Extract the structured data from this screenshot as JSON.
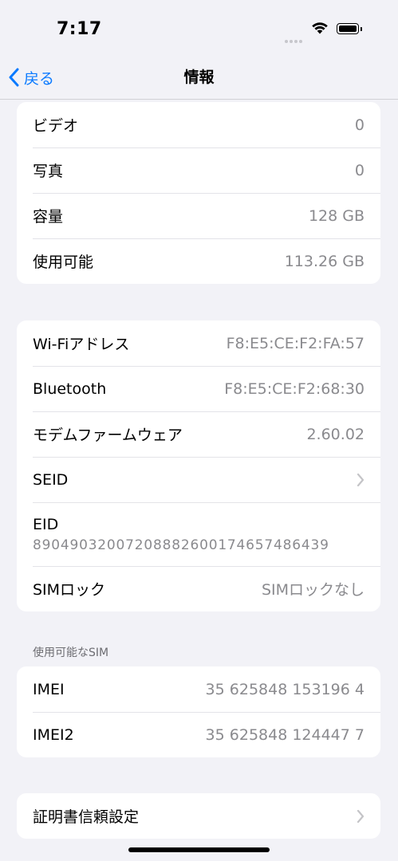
{
  "status_bar": {
    "time": "7:17"
  },
  "nav": {
    "back_label": "戻る",
    "title": "情報"
  },
  "group_storage": [
    {
      "label": "ビデオ",
      "value": "0"
    },
    {
      "label": "写真",
      "value": "0"
    },
    {
      "label": "容量",
      "value": "128 GB"
    },
    {
      "label": "使用可能",
      "value": "113.26 GB"
    }
  ],
  "group_network": {
    "wifi": {
      "label": "Wi-Fiアドレス",
      "value": "F8:E5:CE:F2:FA:57"
    },
    "bluetooth": {
      "label": "Bluetooth",
      "value": "F8:E5:CE:F2:68:30"
    },
    "modem": {
      "label": "モデムファームウェア",
      "value": "2.60.02"
    },
    "seid": {
      "label": "SEID"
    },
    "eid": {
      "label": "EID",
      "value": "89049032007208882600174657486439"
    },
    "sim_lock": {
      "label": "SIMロック",
      "value": "SIMロックなし"
    }
  },
  "sim_section": {
    "header": "使用可能なSIM",
    "imei": {
      "label": "IMEI",
      "value": "35 625848 153196 4"
    },
    "imei2": {
      "label": "IMEI2",
      "value": "35 625848 124447 7"
    }
  },
  "certificates": {
    "label": "証明書信頼設定"
  }
}
